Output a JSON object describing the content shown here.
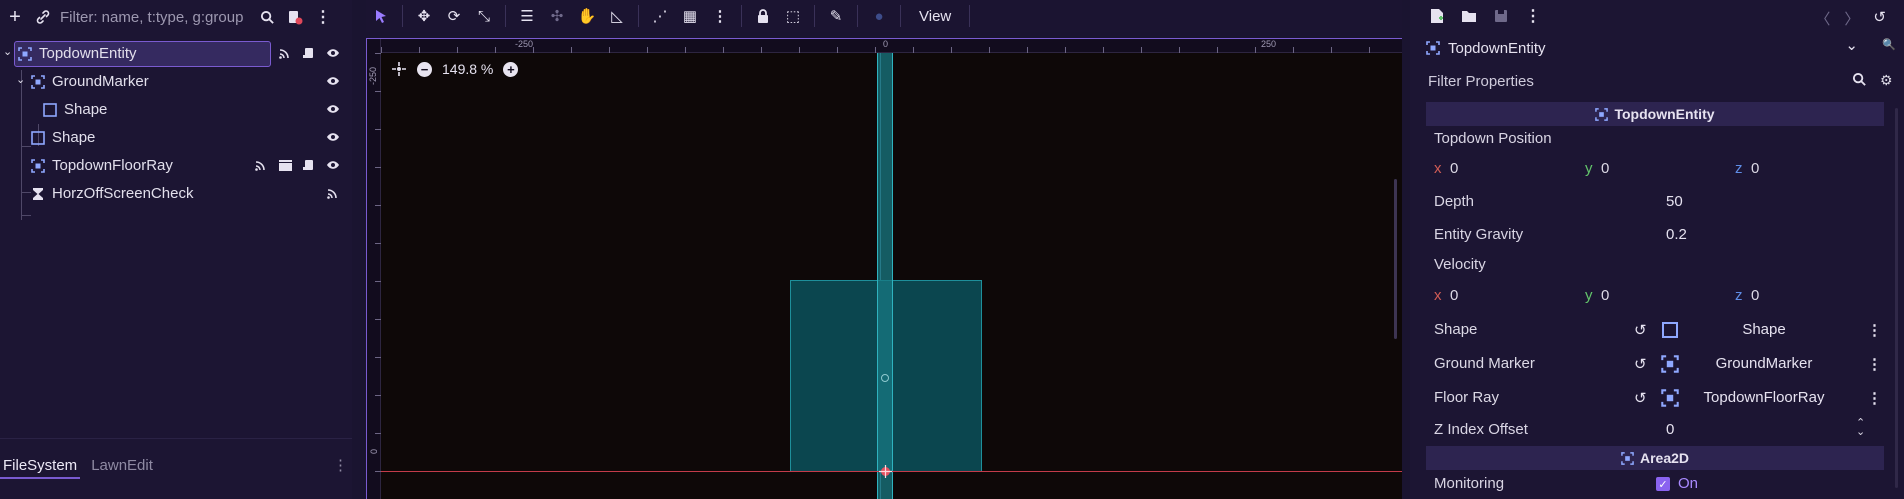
{
  "scene_dock": {
    "filter_placeholder": "Filter: name, t:type, g:group",
    "tree": [
      {
        "label": "TopdownEntity",
        "selected": true
      },
      {
        "label": "GroundMarker"
      },
      {
        "label": "Shape"
      },
      {
        "label": "Shape"
      },
      {
        "label": "TopdownFloorRay"
      },
      {
        "label": "HorzOffScreenCheck"
      }
    ],
    "bottom_tabs": [
      "FileSystem",
      "LawnEdit"
    ]
  },
  "toolbar": {
    "view_label": "View"
  },
  "viewport": {
    "zoom_label": "149.8 %",
    "ruler_top_labels": [
      "-250",
      "0",
      "250"
    ],
    "ruler_left_labels": [
      "-250",
      "0"
    ]
  },
  "inspector": {
    "object_name": "TopdownEntity",
    "filter_placeholder": "Filter Properties",
    "section_topdown": "TopdownEntity",
    "topdown_position_label": "Topdown Position",
    "topdown_position": {
      "x_label": "x",
      "x": "0",
      "y_label": "y",
      "y": "0",
      "z_label": "z",
      "z": "0"
    },
    "depth_label": "Depth",
    "depth_value": "50",
    "gravity_label": "Entity Gravity",
    "gravity_value": "0.2",
    "velocity_label": "Velocity",
    "velocity": {
      "x_label": "x",
      "x": "0",
      "y_label": "y",
      "y": "0",
      "z_label": "z",
      "z": "0"
    },
    "shape_label": "Shape",
    "shape_value": "Shape",
    "ground_marker_label": "Ground Marker",
    "ground_marker_value": "GroundMarker",
    "floor_ray_label": "Floor Ray",
    "floor_ray_value": "TopdownFloorRay",
    "z_index_label": "Z Index Offset",
    "z_index_value": "0",
    "section_area2d": "Area2D",
    "monitoring_label": "Monitoring",
    "monitoring_value": "On"
  },
  "colors": {
    "accent": "#7a5bd0",
    "axis_x": "#d15c56",
    "axis_y": "#63c56b",
    "axis_z": "#5f8de6"
  }
}
